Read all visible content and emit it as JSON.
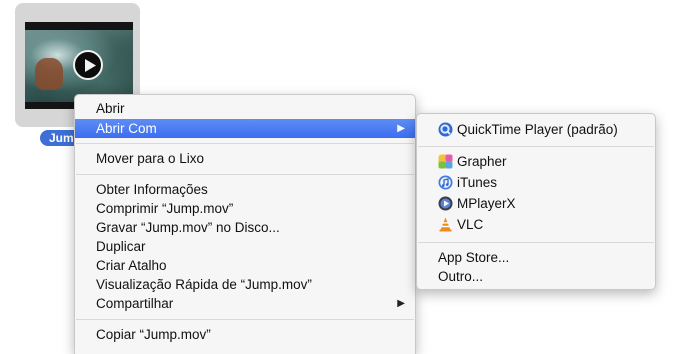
{
  "file": {
    "name": "Jump.mov",
    "label_visible": "Jump",
    "thumbnail_icon": "play-icon"
  },
  "context_menu": {
    "items": [
      {
        "label": "Abrir"
      },
      {
        "label": "Abrir Com",
        "highlighted": true,
        "has_submenu": true
      },
      {
        "label": "Mover para o Lixo"
      },
      {
        "label": "Obter Informações"
      },
      {
        "label": "Comprimir “Jump.mov”"
      },
      {
        "label": "Gravar “Jump.mov” no Disco..."
      },
      {
        "label": "Duplicar"
      },
      {
        "label": "Criar Atalho"
      },
      {
        "label": "Visualização Rápida de “Jump.mov”"
      },
      {
        "label": "Compartilhar",
        "has_submenu": true
      },
      {
        "label": "Copiar “Jump.mov”"
      }
    ],
    "submenu_arrow": "▶"
  },
  "open_with_submenu": {
    "apps": [
      {
        "label": "QuickTime Player (padrão)",
        "icon": "quicktime-icon"
      },
      {
        "label": "Grapher",
        "icon": "grapher-icon"
      },
      {
        "label": "iTunes",
        "icon": "itunes-icon"
      },
      {
        "label": "MPlayerX",
        "icon": "mplayerx-icon"
      },
      {
        "label": "VLC",
        "icon": "vlc-icon"
      }
    ],
    "other": [
      {
        "label": "App Store..."
      },
      {
        "label": "Outro..."
      }
    ]
  },
  "colors": {
    "highlight": "#3b6df0",
    "file_label_bg": "#3d6fd6",
    "menu_bg": "#f6f6f6"
  }
}
